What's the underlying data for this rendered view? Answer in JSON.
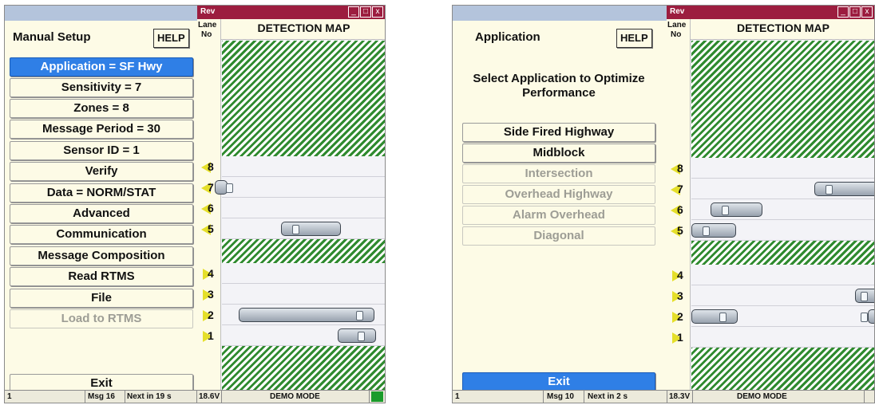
{
  "left": {
    "title": "Manual Setup",
    "help": "HELP",
    "buttons": [
      {
        "label": "Application = SF Hwy"
      },
      {
        "label": "Sensitivity = 7"
      },
      {
        "label": "Zones = 8"
      },
      {
        "label": "Message Period = 30"
      },
      {
        "label": "Sensor ID = 1"
      },
      {
        "label": "Verify"
      },
      {
        "label": "Data = NORM/STAT"
      },
      {
        "label": "Advanced"
      },
      {
        "label": "Communication"
      },
      {
        "label": "Message Composition"
      },
      {
        "label": "Read RTMS"
      },
      {
        "label": "File"
      },
      {
        "label": "Load to RTMS"
      }
    ],
    "exit": "Exit",
    "map": {
      "rev": "Rev",
      "lane_label": "Lane",
      "no_label": "No",
      "title": "DETECTION MAP",
      "lanes": [
        "8",
        "7",
        "6",
        "5",
        "4",
        "3",
        "2",
        "1"
      ]
    },
    "status": {
      "id": "1",
      "msg": "Msg 16",
      "next": "Next in 19 s",
      "voltage": "18.6V",
      "mode": "DEMO MODE"
    }
  },
  "right": {
    "title": "Application",
    "help": "HELP",
    "hint": "Select Application to Optimize Performance",
    "options": [
      {
        "label": "Side Fired Highway"
      },
      {
        "label": "Midblock"
      },
      {
        "label": "Intersection"
      },
      {
        "label": "Overhead Highway"
      },
      {
        "label": "Alarm Overhead"
      },
      {
        "label": "Diagonal"
      }
    ],
    "exit": "Exit",
    "map": {
      "rev": "Rev",
      "lane_label": "Lane",
      "no_label": "No",
      "title": "DETECTION MAP",
      "lanes": [
        "8",
        "7",
        "6",
        "5",
        "4",
        "3",
        "2",
        "1"
      ]
    },
    "status": {
      "id": "1",
      "msg": "Msg 10",
      "next": "Next in 2 s",
      "voltage": "18.3V",
      "mode": "DEMO MODE"
    }
  },
  "window_controls": {
    "minimize": "_",
    "maximize": "□",
    "close": "x"
  },
  "colors": {
    "header": "#9c1d3f",
    "selected": "#2f7fe6",
    "hatch": "#2f8a2f",
    "lane_arrow": "#e5df2a",
    "status_led": "#1a9b2b"
  }
}
